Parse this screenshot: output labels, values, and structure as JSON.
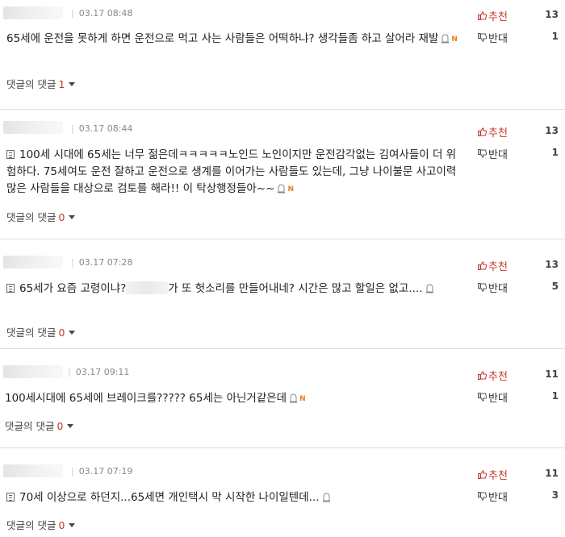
{
  "comments": [
    {
      "timestamp": "03.17 08:48",
      "upvote_label": "추천",
      "upvote_count": "13",
      "downvote_label": "반대",
      "downvote_count": "1",
      "text": "65세에 운전을 못하게 하면 운전으로 먹고 사는 사람들은 어떡하냐? 생각들좀 하고 살어라 재발",
      "reply_label": "댓글의 댓글",
      "reply_count": "1",
      "new_badge": "N"
    },
    {
      "timestamp": "03.17 08:44",
      "upvote_label": "추천",
      "upvote_count": "13",
      "downvote_label": "반대",
      "downvote_count": "1",
      "text": "100세 시대에 65세는 너무 젊은데ㅋㅋㅋㅋㅋ노인드 노인이지만 운전감각없는 김여사들이 더 위험하다. 75세여도 운전 잘하고 운전으로 생계를 이어가는 사람들도 있는데, 그냥 나이불문 사고이력 많은 사람들을 대상으로 검토를 해라!! 이 탁상행정들아~~",
      "reply_label": "댓글의 댓글",
      "reply_count": "0",
      "new_badge": "N"
    },
    {
      "timestamp": "03.17 07:28",
      "upvote_label": "추천",
      "upvote_count": "13",
      "downvote_label": "반대",
      "downvote_count": "5",
      "text_before": "65세가 요즘 고령이냐?",
      "text_after": "가 또 헛소리를 만들어내네? 시간은 많고 할일은 없고....",
      "reply_label": "댓글의 댓글",
      "reply_count": "0"
    },
    {
      "timestamp": "03.17 09:11",
      "upvote_label": "추천",
      "upvote_count": "11",
      "downvote_label": "반대",
      "downvote_count": "1",
      "text": "100세시대에 65세에 브레이크를????? 65세는 아닌거같은데",
      "reply_label": "댓글의 댓글",
      "reply_count": "0",
      "new_badge": "N"
    },
    {
      "timestamp": "03.17 07:19",
      "upvote_label": "추천",
      "upvote_count": "11",
      "downvote_label": "반대",
      "downvote_count": "3",
      "text": "70세 이상으로 하던지...65세면 개인택시 막 시작한 나이일텐데...",
      "reply_label": "댓글의 댓글",
      "reply_count": "0"
    }
  ]
}
